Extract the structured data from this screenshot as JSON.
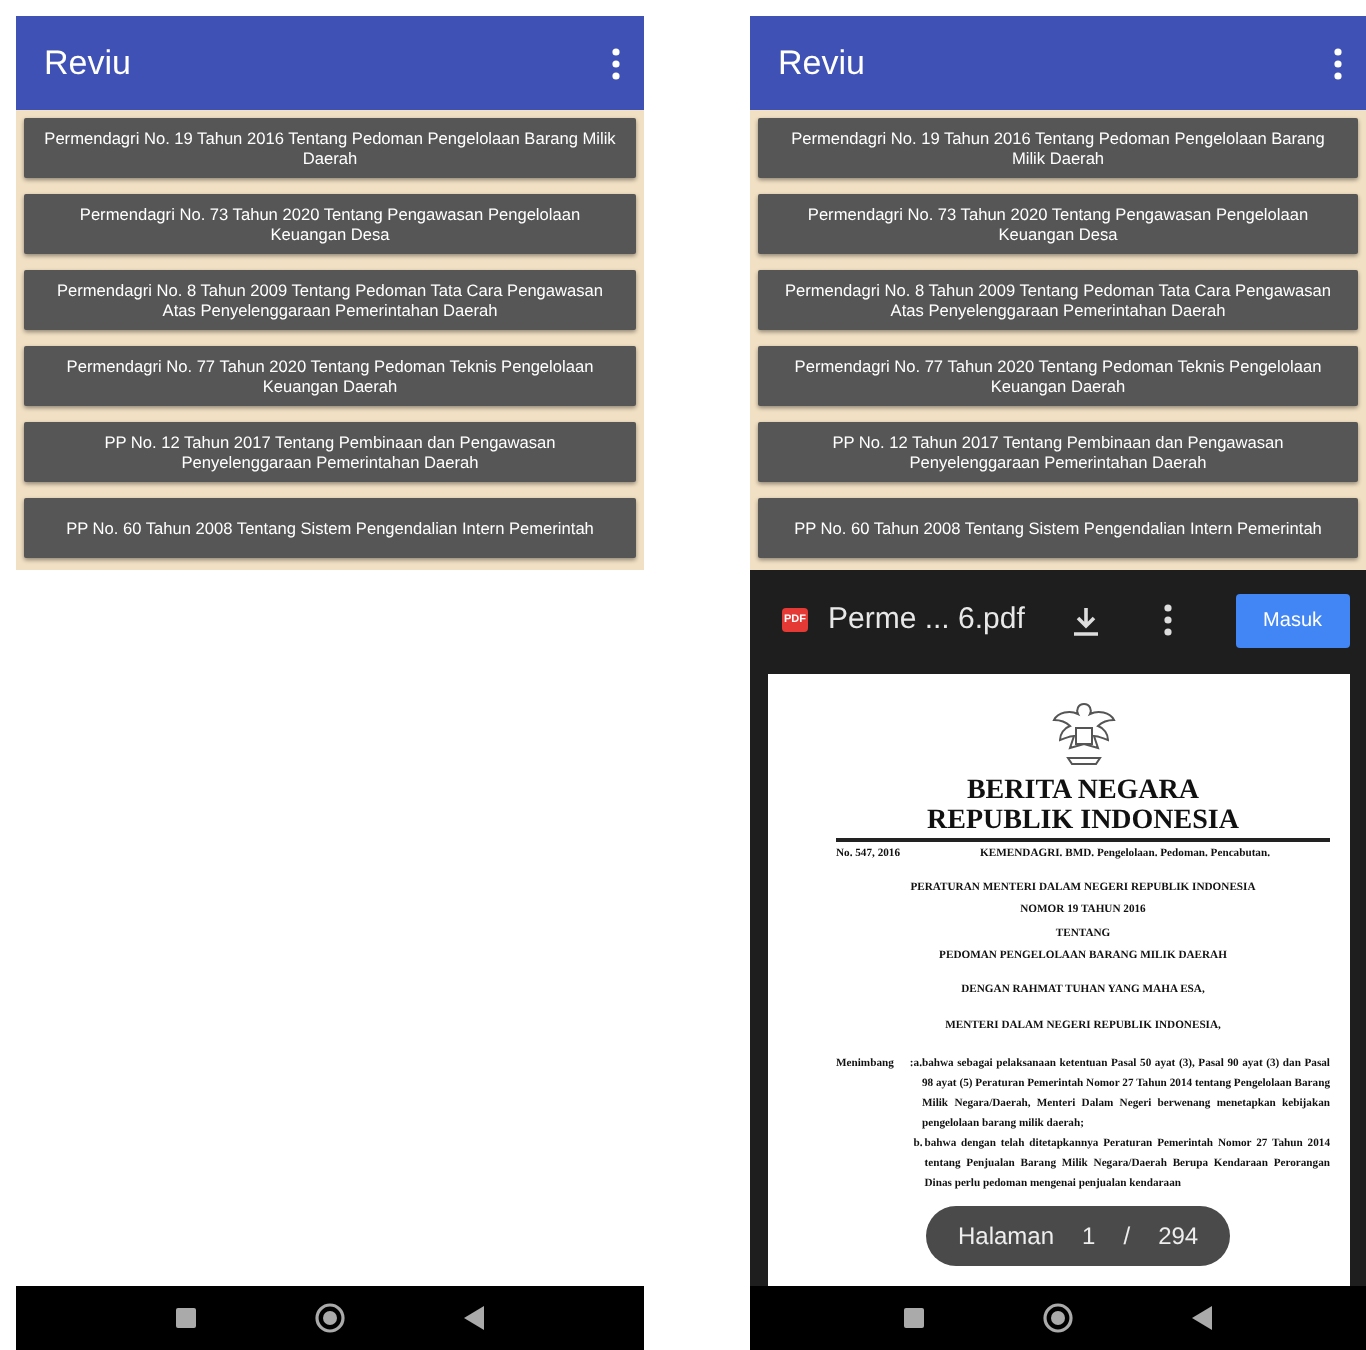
{
  "phones": [
    {
      "app_bar": {
        "title": "Reviu"
      },
      "items": [
        "Permendagri No. 19 Tahun 2016 Tentang Pedoman Pengelolaan Barang Milik Daerah",
        "Permendagri No. 73 Tahun 2020 Tentang Pengawasan Pengelolaan Keuangan Desa",
        "Permendagri No. 8 Tahun 2009 Tentang Pedoman Tata Cara Pengawasan Atas Penyelenggaraan Pemerintahan Daerah",
        "Permendagri No. 77 Tahun 2020 Tentang Pedoman Teknis Pengelolaan Keuangan Daerah",
        "PP No. 12 Tahun 2017 Tentang Pembinaan dan Pengawasan Penyelenggaraan Pemerintahan Daerah",
        "PP No. 60 Tahun 2008 Tentang Sistem Pengendalian Intern Pemerintah"
      ]
    },
    {
      "app_bar": {
        "title": "Reviu"
      },
      "items": [
        "Permendagri No. 19 Tahun 2016 Tentang Pedoman Pengelolaan Barang Milik Daerah",
        "Permendagri No. 73 Tahun 2020 Tentang Pengawasan Pengelolaan Keuangan Desa",
        "Permendagri No. 8 Tahun 2009 Tentang Pedoman Tata Cara Pengawasan Atas Penyelenggaraan Pemerintahan Daerah",
        "Permendagri No. 77 Tahun 2020 Tentang Pedoman Teknis Pengelolaan Keuangan Daerah",
        "PP No. 12 Tahun 2017 Tentang Pembinaan dan Pengawasan Penyelenggaraan Pemerintahan Daerah",
        "PP No. 60 Tahun 2008 Tentang Sistem Pengendalian Intern Pemerintah"
      ],
      "pdf_viewer": {
        "file_badge": "PDF",
        "file_name": "Perme ... 6.pdf",
        "login_button": "Masuk",
        "document": {
          "masthead": [
            "BERITA NEGARA",
            "REPUBLIK INDONESIA"
          ],
          "number": "No. 547, 2016",
          "keywords": "KEMENDAGRI. BMD. Pengelolaan. Pedoman. Pencabutan.",
          "title_lines": [
            "PERATURAN MENTERI DALAM NEGERI REPUBLIK INDONESIA",
            "NOMOR 19 TAHUN 2016",
            "TENTANG",
            "PEDOMAN PENGELOLAAN BARANG MILIK DAERAH"
          ],
          "preamble": [
            "DENGAN RAHMAT TUHAN YANG MAHA ESA,",
            "MENTERI DALAM NEGERI REPUBLIK INDONESIA,"
          ],
          "considering": {
            "label": "Menimbang",
            "colon": ":",
            "points": [
              {
                "marker": "a.",
                "text": "bahwa sebagai pelaksanaan ketentuan Pasal 50 ayat (3), Pasal 90 ayat (3) dan Pasal 98 ayat (5) Peraturan Pemerintah Nomor 27 Tahun 2014 tentang Pengelolaan Barang Milik Negara/Daerah, Menteri Dalam Negeri berwenang menetapkan kebijakan pengelolaan barang milik daerah;"
              },
              {
                "marker": "b.",
                "text": "bahwa dengan telah ditetapkannya Peraturan Pemerintah Nomor 27 Tahun 2014 tentang Penjualan Barang Milik Negara/Daerah Berupa Kendaraan Perorangan Dinas perlu pedoman mengenai penjualan kendaraan"
              }
            ]
          }
        },
        "page_indicator": {
          "label": "Halaman",
          "current": "1",
          "separator": "/",
          "total": "294"
        }
      }
    }
  ]
}
